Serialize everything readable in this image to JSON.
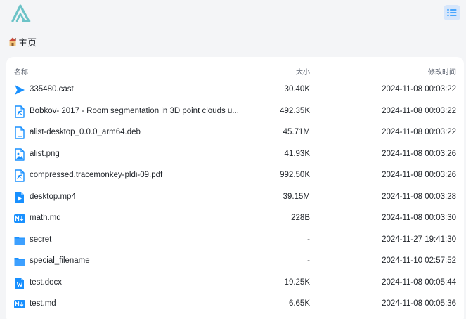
{
  "breadcrumb": {
    "home_label": "主页"
  },
  "table": {
    "headers": {
      "name": "名称",
      "size": "大小",
      "modified": "修改时间"
    },
    "rows": [
      {
        "name": "335480.cast",
        "size": "30.40K",
        "modified": "2024-11-08 00:03:22",
        "icon": "video-cast-icon"
      },
      {
        "name": "Bobkov- 2017 - Room segmentation in 3D point clouds u...",
        "size": "492.35K",
        "modified": "2024-11-08 00:03:22",
        "icon": "pdf-file-icon"
      },
      {
        "name": "alist-desktop_0.0.0_arm64.deb",
        "size": "45.71M",
        "modified": "2024-11-08 00:03:22",
        "icon": "file-icon"
      },
      {
        "name": "alist.png",
        "size": "41.93K",
        "modified": "2024-11-08 00:03:26",
        "icon": "image-file-icon"
      },
      {
        "name": "compressed.tracemonkey-pldi-09.pdf",
        "size": "992.50K",
        "modified": "2024-11-08 00:03:26",
        "icon": "pdf-file-icon"
      },
      {
        "name": "desktop.mp4",
        "size": "39.15M",
        "modified": "2024-11-08 00:03:28",
        "icon": "video-file-icon"
      },
      {
        "name": "math.md",
        "size": "228B",
        "modified": "2024-11-08 00:03:30",
        "icon": "markdown-file-icon"
      },
      {
        "name": "secret",
        "size": "-",
        "modified": "2024-11-27 19:41:30",
        "icon": "folder-icon"
      },
      {
        "name": "special_filename",
        "size": "-",
        "modified": "2024-11-10 02:57:52",
        "icon": "folder-icon"
      },
      {
        "name": "test.docx",
        "size": "19.25K",
        "modified": "2024-11-08 00:05:44",
        "icon": "word-file-icon"
      },
      {
        "name": "test.md",
        "size": "6.65K",
        "modified": "2024-11-08 00:05:36",
        "icon": "markdown-file-icon"
      }
    ]
  },
  "colors": {
    "accent": "#1890ff",
    "page_bg": "#f4f5f7",
    "logo": "#6cc3c7"
  }
}
